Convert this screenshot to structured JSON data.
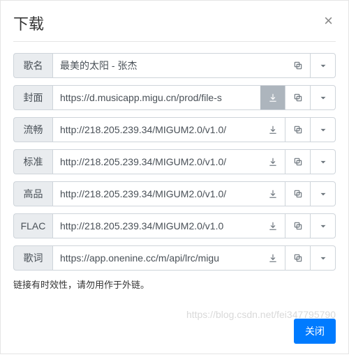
{
  "title": "下载",
  "note": "链接有时效性，请勿用作于外链。",
  "close_btn": "关闭",
  "watermark": "https://blog.csdn.net/fei347795790",
  "rows": [
    {
      "label": "歌名",
      "value": "最美的太阳 - 张杰",
      "download": false,
      "dl_disabled": false
    },
    {
      "label": "封面",
      "value": "https://d.musicapp.migu.cn/prod/file-s",
      "download": true,
      "dl_disabled": true
    },
    {
      "label": "流畅",
      "value": "http://218.205.239.34/MIGUM2.0/v1.0/",
      "download": true,
      "dl_disabled": false
    },
    {
      "label": "标准",
      "value": "http://218.205.239.34/MIGUM2.0/v1.0/",
      "download": true,
      "dl_disabled": false
    },
    {
      "label": "高品",
      "value": "http://218.205.239.34/MIGUM2.0/v1.0/",
      "download": true,
      "dl_disabled": false
    },
    {
      "label": "FLAC",
      "value": "http://218.205.239.34/MIGUM2.0/v1.0",
      "download": true,
      "dl_disabled": false
    },
    {
      "label": "歌词",
      "value": "https://app.onenine.cc/m/api/lrc/migu",
      "download": true,
      "dl_disabled": false
    }
  ]
}
